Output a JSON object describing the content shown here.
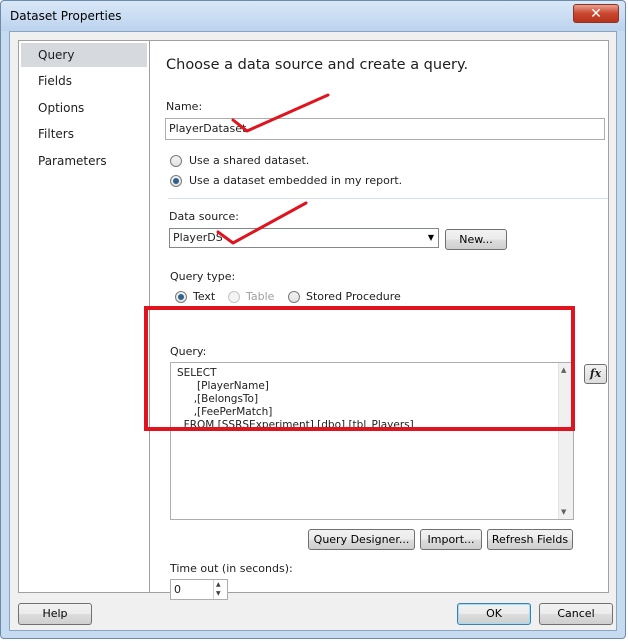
{
  "window": {
    "title": "Dataset Properties",
    "close_glyph": "✕"
  },
  "nav": {
    "items": [
      "Query",
      "Fields",
      "Options",
      "Filters",
      "Parameters"
    ]
  },
  "main": {
    "heading": "Choose a data source and create a query.",
    "name_label": "Name:",
    "name_value": "PlayerDataset",
    "radio_shared": "Use a shared dataset.",
    "radio_embedded": "Use a dataset embedded in my report.",
    "datasource_label": "Data source:",
    "datasource_value": "PlayerDS",
    "new_button": "New...",
    "querytype_label": "Query type:",
    "qt_text": "Text",
    "qt_table": "Table",
    "qt_sp": "Stored Procedure",
    "query_label": "Query:",
    "query_lines": [
      "SELECT",
      "      [PlayerName]",
      "     ,[BelongsTo]",
      "     ,[FeePerMatch]",
      "  FROM [SSRSExperiment].[dbo].[tbl_Players]"
    ],
    "query_designer_button": "Query Designer...",
    "import_button": "Import...",
    "refresh_button": "Refresh Fields",
    "timeout_label": "Time out (in seconds):",
    "timeout_value": "0"
  },
  "footer": {
    "help": "Help",
    "ok": "OK",
    "cancel": "Cancel"
  },
  "icons": {
    "fx": "fx"
  },
  "colors": {
    "annotation_red": "#e0141e",
    "selection_gray": "#d6d9dd",
    "default_button_border": "#3c7fb1"
  }
}
